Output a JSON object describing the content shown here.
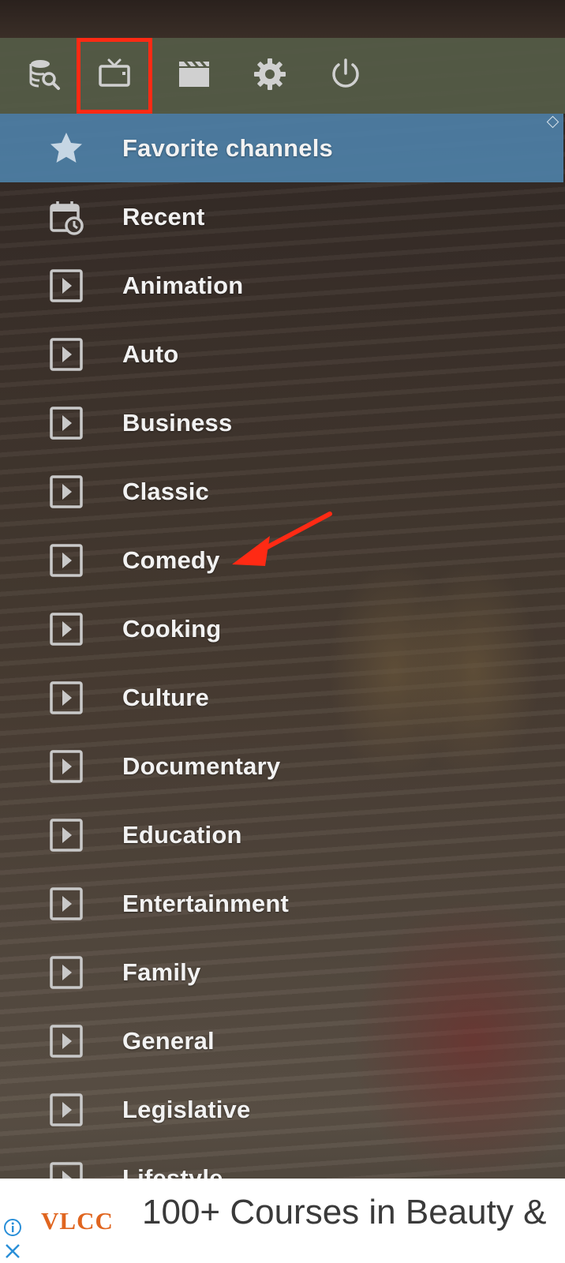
{
  "toolbar": {
    "buttons": [
      {
        "name": "search-database",
        "icon": "database-search-icon"
      },
      {
        "name": "live-tv",
        "icon": "tv-icon",
        "highlighted": true
      },
      {
        "name": "movies",
        "icon": "clapperboard-icon"
      },
      {
        "name": "settings",
        "icon": "gear-icon"
      },
      {
        "name": "power",
        "icon": "power-icon"
      }
    ]
  },
  "menu": {
    "items": [
      {
        "label": "Favorite channels",
        "icon": "star-icon",
        "active": true
      },
      {
        "label": "Recent",
        "icon": "calendar-clock-icon"
      },
      {
        "label": "Animation",
        "icon": "play-box-icon"
      },
      {
        "label": "Auto",
        "icon": "play-box-icon"
      },
      {
        "label": "Business",
        "icon": "play-box-icon"
      },
      {
        "label": "Classic",
        "icon": "play-box-icon"
      },
      {
        "label": "Comedy",
        "icon": "play-box-icon"
      },
      {
        "label": "Cooking",
        "icon": "play-box-icon"
      },
      {
        "label": "Culture",
        "icon": "play-box-icon"
      },
      {
        "label": "Documentary",
        "icon": "play-box-icon"
      },
      {
        "label": "Education",
        "icon": "play-box-icon"
      },
      {
        "label": "Entertainment",
        "icon": "play-box-icon"
      },
      {
        "label": "Family",
        "icon": "play-box-icon"
      },
      {
        "label": "General",
        "icon": "play-box-icon"
      },
      {
        "label": "Legislative",
        "icon": "play-box-icon"
      },
      {
        "label": "Lifestyle",
        "icon": "play-box-icon"
      }
    ]
  },
  "annotation": {
    "arrow_target": "Comedy",
    "arrow_color": "#ff2a14",
    "highlight_color": "#ff2a14"
  },
  "ad": {
    "brand": "VLCC",
    "headline": "100+ Courses in Beauty &",
    "info_icon": "info-icon",
    "close_icon": "close-icon"
  },
  "colors": {
    "toolbar_bg": "#565c48",
    "active_item_bg": "#4d7fa6",
    "label_text": "#f2f2f2",
    "icon_gray": "#c9c9c9",
    "brand_orange": "#e0651f"
  }
}
